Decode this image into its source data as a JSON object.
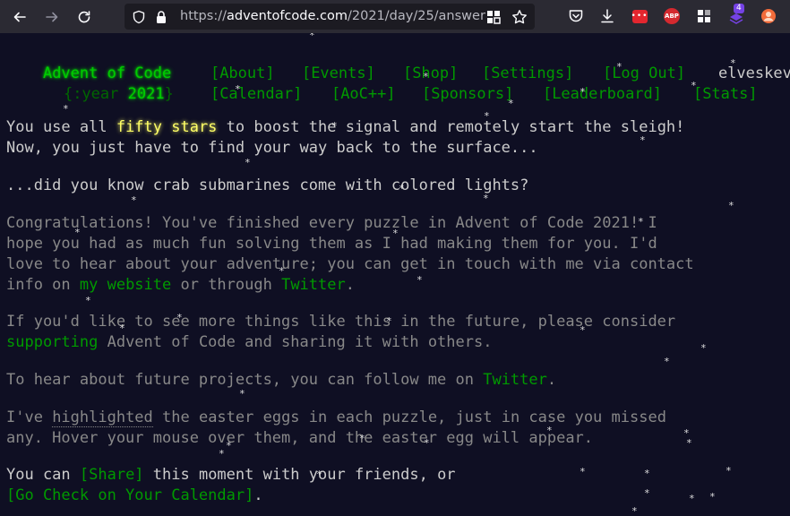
{
  "browser": {
    "url_prefix": "https://",
    "url_host": "adventofcode.com",
    "url_path": "/2021/day/25/answer",
    "extension_badge": "4",
    "abp_label": "ABP"
  },
  "header": {
    "title": "Advent of Code",
    "nav_row1": [
      "[About]",
      "[Events]",
      "[Shop]",
      "[Settings]",
      "[Log Out]"
    ],
    "user": "elveskevtar",
    "year_prefix": "{:year ",
    "year_value": "2021",
    "year_suffix": "}",
    "nav_row2": [
      "[Calendar]",
      "[AoC++]",
      "[Sponsors]",
      "[Leaderboard]",
      "[Stats]"
    ]
  },
  "content": {
    "p1_a": "You use all ",
    "p1_stars": "fifty stars",
    "p1_b": " to boost the signal and remotely start the sleigh!",
    "p1_line2": "Now, you just have to find your way back to the surface...",
    "p2": "...did you know crab submarines come with colored lights?",
    "p3_line1": "Congratulations! You've finished every puzzle in Advent of Code 2021! I",
    "p3_line2": "hope you had as much fun solving them as I had making them for you. I'd",
    "p3_line3": "love to hear about your adventure; you can get in touch with me via contact",
    "p3_line4_a": "info on ",
    "p3_link_website": "my website",
    "p3_line4_b": " or through ",
    "p3_link_twitter": "Twitter",
    "p3_line4_c": ".",
    "p4_line1": "If you'd like to see more things like this in the future, please consider",
    "p4_link_supporting": "supporting",
    "p4_line2_rest": " Advent of Code and sharing it with others.",
    "p5_a": "To hear about future projects, you can follow me on ",
    "p5_link_twitter": "Twitter",
    "p5_b": ".",
    "p6_a": "I've ",
    "p6_highlighted": "highlighted",
    "p6_b": " the easter eggs in each puzzle, just in case you missed",
    "p6_line2": "any. Hover your mouse over them, and the easter egg will appear.",
    "p7_a": "You can ",
    "p7_share": "[Share]",
    "p7_b": " this moment with your friends, or",
    "p7_calendar": "[Go Check on Your Calendar]",
    "p7_c": "."
  },
  "snowflake_glyph": "*",
  "colors": {
    "background": "#0f0f23",
    "text": "#cccccc",
    "link": "#009900",
    "title": "#00cc00",
    "stars": "#ffff66"
  }
}
